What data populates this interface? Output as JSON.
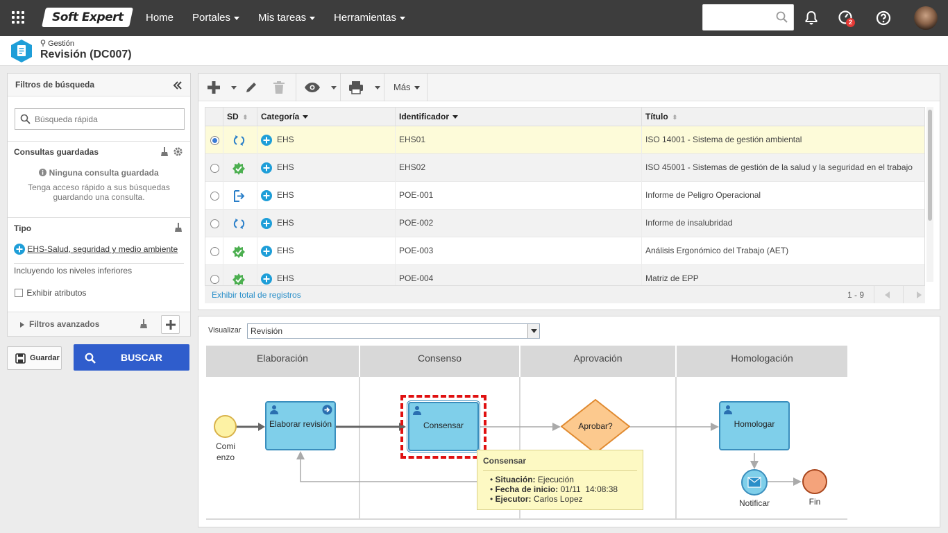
{
  "topbar": {
    "logo_text": "Soft Expert",
    "nav": [
      {
        "label": "Home",
        "has_menu": false
      },
      {
        "label": "Portales",
        "has_menu": true
      },
      {
        "label": "Mis tareas",
        "has_menu": true
      },
      {
        "label": "Herramientas",
        "has_menu": true
      }
    ],
    "search_value": "",
    "notification_badge": "2"
  },
  "header": {
    "breadcrumb": "Gestión",
    "title": "Revisión (DC007)"
  },
  "filters": {
    "title": "Filtros de búsqueda",
    "quick_search_placeholder": "Búsqueda rápida",
    "saved_queries_title": "Consultas guardadas",
    "no_queries": "Ninguna consulta guardada",
    "no_queries_hint": "Tenga acceso rápido a sus búsquedas guardando una consulta.",
    "type_title": "Tipo",
    "type_value": "EHS-Salud, seguridad y medio ambiente",
    "include_lower": "Incluyendo los niveles inferiores",
    "show_attributes": "Exhibir atributos",
    "advanced": "Filtros avanzados"
  },
  "buttons": {
    "save": "Guardar",
    "search": "BUSCAR"
  },
  "toolbar": {
    "more": "Más"
  },
  "table": {
    "columns": [
      "SD",
      "Categoría",
      "Identificador",
      "Título"
    ],
    "rows": [
      {
        "status": "cycle",
        "category": "EHS",
        "id": "EHS01",
        "title": "ISO 14001 - Sistema de gestión ambiental",
        "selected": true
      },
      {
        "status": "approved",
        "category": "EHS",
        "id": "EHS02",
        "title": "ISO 45001 - Sistemas de gestión de la salud y la seguridad en el trabajo",
        "selected": false
      },
      {
        "status": "arrow",
        "category": "EHS",
        "id": "POE-001",
        "title": "Informe de Peligro Operacional",
        "selected": false
      },
      {
        "status": "cycle",
        "category": "EHS",
        "id": "POE-002",
        "title": "Informe de insalubridad",
        "selected": false
      },
      {
        "status": "approved",
        "category": "EHS",
        "id": "POE-003",
        "title": "Análisis Ergonómico del Trabajo (AET)",
        "selected": false
      },
      {
        "status": "approved",
        "category": "EHS",
        "id": "POE-004",
        "title": "Matriz de EPP",
        "selected": false
      }
    ],
    "show_total": "Exhibir total de registros",
    "pagination": "1 - 9"
  },
  "workflow": {
    "view_label": "Visualizar",
    "view_value": "Revisión",
    "lanes": [
      "Elaboración",
      "Consenso",
      "Aprovación",
      "Homologación"
    ],
    "start_label": "Comi\nenzo",
    "task_elaborate": "Elaborar revisión",
    "task_consensus": "Consensar",
    "gateway": "Aprobar?",
    "task_homolog": "Homologar",
    "notify": "Notificar",
    "end": "Fin",
    "tooltip": {
      "title": "Consensar",
      "status_label": "Situación:",
      "status_value": "Ejecución",
      "start_label": "Fecha de inicio:",
      "start_value": "01/11  14:08:38",
      "executor_label": "Ejecutor:",
      "executor_value": "Carlos Lopez"
    }
  },
  "colors": {
    "topbar": "#3d3d3d",
    "primary_button": "#2f5dcc",
    "selected_row": "#fdfbd9",
    "task_fill": "#7fcfea",
    "gateway_fill": "#fcc98e",
    "highlight": "#e01010"
  }
}
